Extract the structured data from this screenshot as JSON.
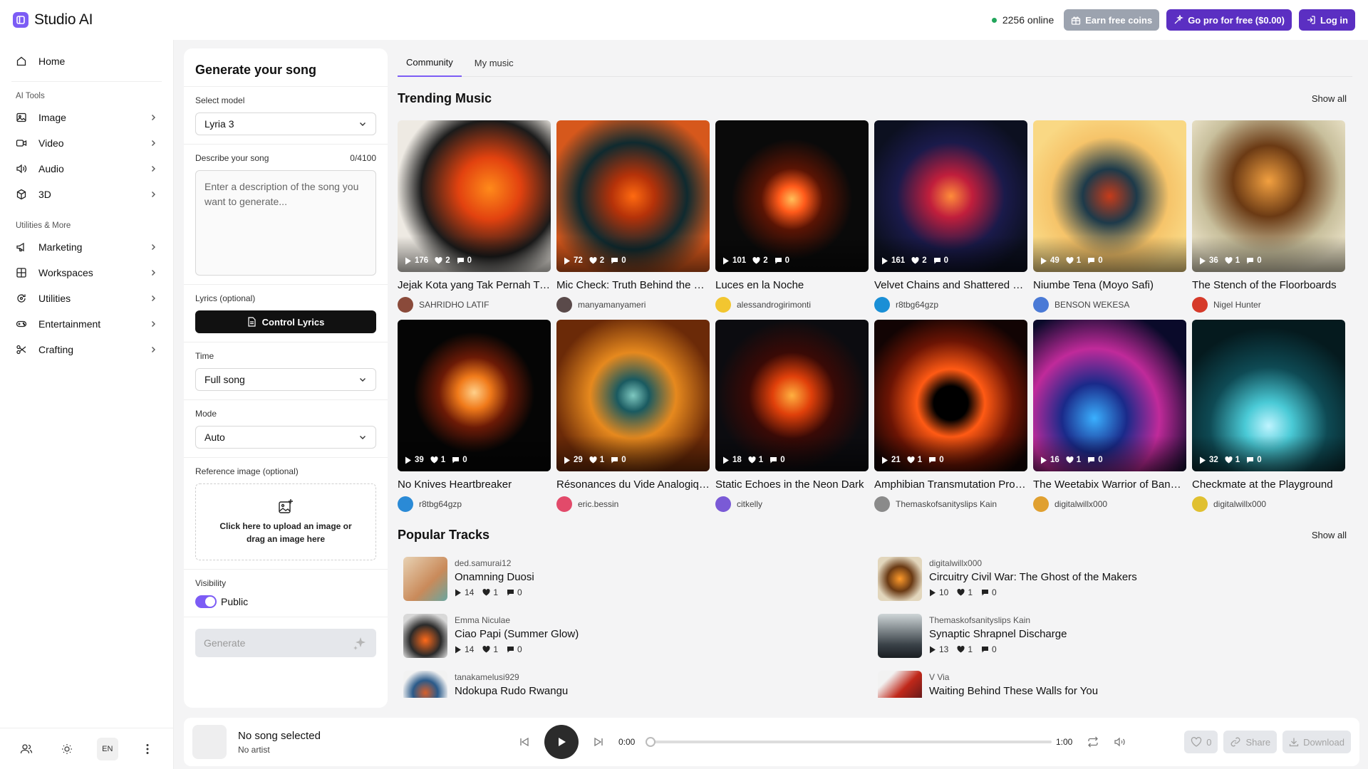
{
  "app": {
    "name": "Studio AI"
  },
  "header": {
    "online_text": "2256 online",
    "earn_label": "Earn free coins",
    "pro_label": "Go pro for free ($0.00)",
    "login_label": "Log in",
    "accent": "#5b2fc2"
  },
  "sidebar": {
    "home": "Home",
    "ai_tools_title": "AI Tools",
    "ai_tools": [
      {
        "label": "Image",
        "icon": "image-icon"
      },
      {
        "label": "Video",
        "icon": "video-icon"
      },
      {
        "label": "Audio",
        "icon": "audio-icon"
      },
      {
        "label": "3D",
        "icon": "cube-icon"
      }
    ],
    "utilities_title": "Utilities & More",
    "utilities": [
      {
        "label": "Marketing",
        "icon": "megaphone-icon"
      },
      {
        "label": "Workspaces",
        "icon": "grid-icon"
      },
      {
        "label": "Utilities",
        "icon": "refresh-icon"
      },
      {
        "label": "Entertainment",
        "icon": "gamepad-icon"
      },
      {
        "label": "Crafting",
        "icon": "scissors-icon"
      }
    ],
    "lang": "EN"
  },
  "form": {
    "title": "Generate your song",
    "model_label": "Select model",
    "model_value": "Lyria 3",
    "describe_label": "Describe your song",
    "describe_count": "0/4100",
    "describe_placeholder": "Enter a description of the song you want to generate...",
    "lyrics_label": "Lyrics (optional)",
    "lyrics_button": "Control Lyrics",
    "time_label": "Time",
    "time_value": "Full song",
    "mode_label": "Mode",
    "mode_value": "Auto",
    "ref_label": "Reference image (optional)",
    "upload_text": "Click here to upload an image or drag an image here",
    "visibility_label": "Visibility",
    "visibility_value": "Public",
    "generate_label": "Generate"
  },
  "main": {
    "tabs": [
      "Community",
      "My music"
    ],
    "trending_title": "Trending Music",
    "popular_title": "Popular Tracks",
    "show_all": "Show all",
    "trending": [
      {
        "title": "Jejak Kota yang Tak Pernah Tidur",
        "author": "SAHRIDHO LATIF",
        "plays": "176",
        "likes": "2",
        "comments": "0"
      },
      {
        "title": "Mic Check: Truth Behind the Rhyme",
        "author": "manyamanyameri",
        "plays": "72",
        "likes": "2",
        "comments": "0"
      },
      {
        "title": "Luces en la Noche",
        "author": "alessandrogirimonti",
        "plays": "101",
        "likes": "2",
        "comments": "0"
      },
      {
        "title": "Velvet Chains and Shattered Glass",
        "author": "r8tbg64gzp",
        "plays": "161",
        "likes": "2",
        "comments": "0"
      },
      {
        "title": "Niumbe Tena (Moyo Safi)",
        "author": "BENSON WEKESA",
        "plays": "49",
        "likes": "1",
        "comments": "0"
      },
      {
        "title": "The Stench of the Floorboards",
        "author": "Nigel Hunter",
        "plays": "36",
        "likes": "1",
        "comments": "0"
      },
      {
        "title": "No Knives Heartbreaker",
        "author": "r8tbg64gzp",
        "plays": "39",
        "likes": "1",
        "comments": "0"
      },
      {
        "title": "Résonances du Vide Analogique",
        "author": "eric.bessin",
        "plays": "29",
        "likes": "1",
        "comments": "0"
      },
      {
        "title": "Static Echoes in the Neon Dark",
        "author": "citkelly",
        "plays": "18",
        "likes": "1",
        "comments": "0"
      },
      {
        "title": "Amphibian Transmutation Protocol",
        "author": "Themaskofsanityslips Kain",
        "plays": "21",
        "likes": "1",
        "comments": "0"
      },
      {
        "title": "The Weetabix Warrior of Banbury",
        "author": "digitalwillx000",
        "plays": "16",
        "likes": "1",
        "comments": "0"
      },
      {
        "title": "Checkmate at the Playground",
        "author": "digitalwillx000",
        "plays": "32",
        "likes": "1",
        "comments": "0"
      }
    ],
    "popular": [
      {
        "artist": "ded.samurai12",
        "title": "Onamning Duosi",
        "plays": "14",
        "likes": "1",
        "comments": "0"
      },
      {
        "artist": "digitalwillx000",
        "title": "Circuitry Civil War: The Ghost of the Makers",
        "plays": "10",
        "likes": "1",
        "comments": "0"
      },
      {
        "artist": "Emma Niculae",
        "title": "Ciao Papi (Summer Glow)",
        "plays": "14",
        "likes": "1",
        "comments": "0"
      },
      {
        "artist": "Themaskofsanityslips Kain",
        "title": "Synaptic Shrapnel Discharge",
        "plays": "13",
        "likes": "1",
        "comments": "0"
      },
      {
        "artist": "tanakamelusi929",
        "title": "Ndokupa Rudo Rwangu",
        "plays": "",
        "likes": "",
        "comments": ""
      },
      {
        "artist": "V Via",
        "title": "Waiting Behind These Walls for You",
        "plays": "",
        "likes": "",
        "comments": ""
      }
    ]
  },
  "player": {
    "title": "No song selected",
    "artist": "No artist",
    "current_time": "0:00",
    "total_time": "1:00",
    "progress": 0,
    "likes": "0",
    "share_label": "Share",
    "download_label": "Download"
  }
}
